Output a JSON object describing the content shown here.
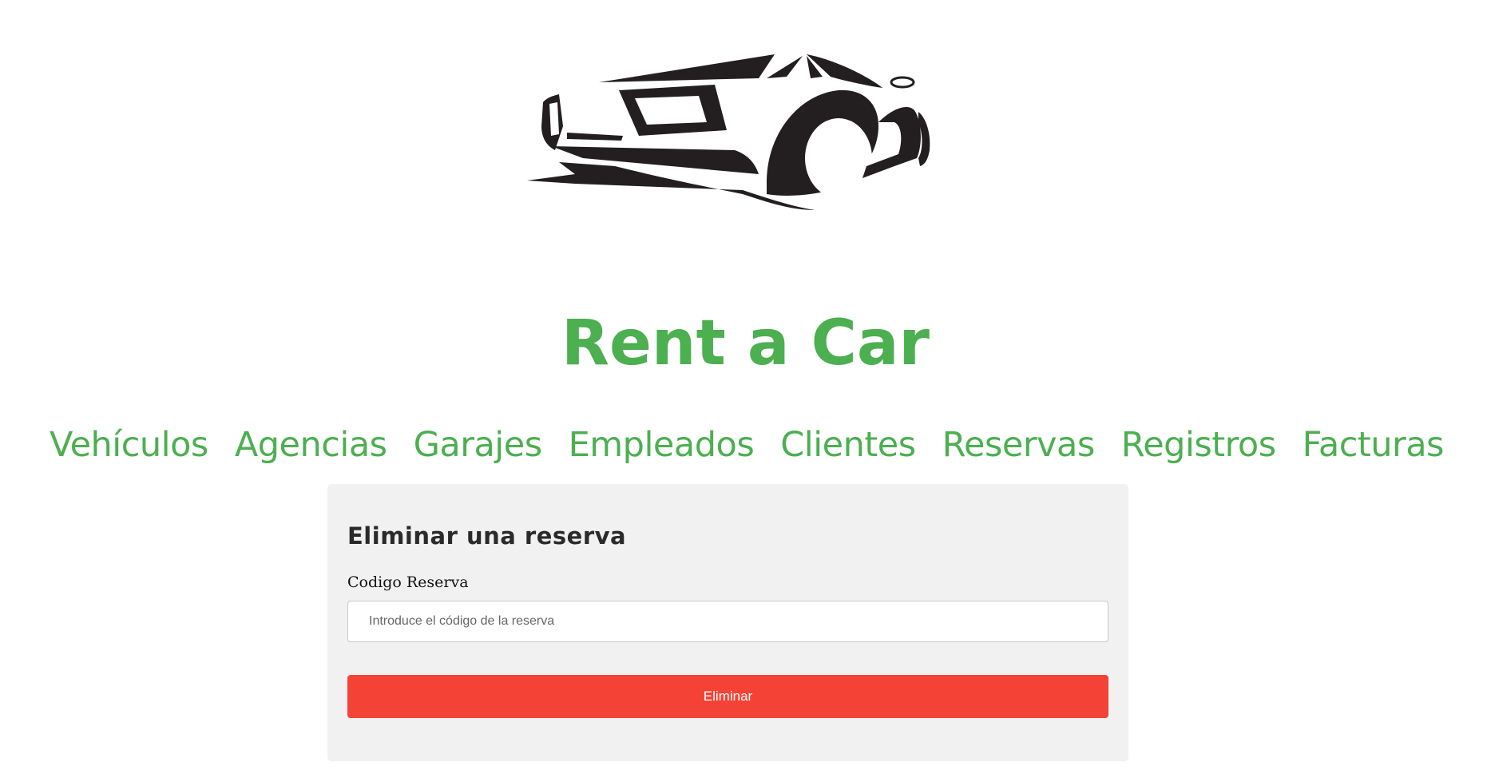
{
  "header": {
    "logo_icon": "car-silhouette-icon",
    "title": "Rent a Car"
  },
  "nav": {
    "items": [
      {
        "label": "Vehículos"
      },
      {
        "label": "Agencias"
      },
      {
        "label": "Garajes"
      },
      {
        "label": "Empleados"
      },
      {
        "label": "Clientes"
      },
      {
        "label": "Reservas"
      },
      {
        "label": "Registros"
      },
      {
        "label": "Facturas"
      }
    ],
    "color": "#4caf50"
  },
  "form": {
    "title": "Eliminar una reserva",
    "code_label": "Codigo Reserva",
    "code_value": "",
    "code_placeholder": "Introduce el código de la reserva",
    "submit_label": "Eliminar",
    "submit_color": "#f44336",
    "card_background": "#f1f1f1"
  }
}
